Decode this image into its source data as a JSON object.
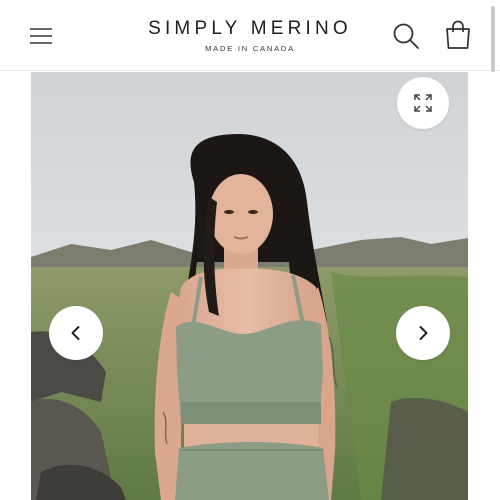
{
  "header": {
    "brand_name": "SIMPLY MERINO",
    "brand_tagline": "MADE IN CANADA",
    "icons": {
      "menu": "hamburger-menu-icon",
      "search": "search-icon",
      "cart": "shopping-bag-icon"
    }
  },
  "gallery": {
    "image_subject": "model wearing sage green crop top and shorts outdoors",
    "controls": {
      "zoom": "expand-icon",
      "previous": "chevron-left-icon",
      "next": "chevron-right-icon"
    }
  },
  "colors": {
    "product_sage_green": "#8c9c85",
    "header_background": "#ffffff",
    "text": "#1f1f1f"
  }
}
